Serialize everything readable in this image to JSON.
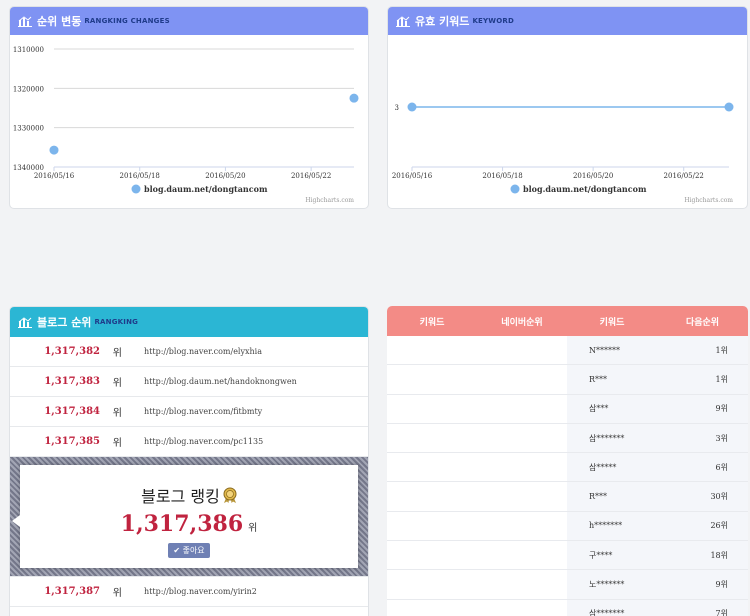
{
  "rank_chart": {
    "title": "순위 변동",
    "subtitle": "RANGKING CHANGES",
    "credit": "Highcharts.com",
    "chart_data": {
      "type": "scatter",
      "x": [
        "2016/05/16",
        "2016/05/23"
      ],
      "y": [
        1335700,
        1322500
      ],
      "xticks": [
        "2016/05/16",
        "2016/05/18",
        "2016/05/20",
        "2016/05/22"
      ],
      "yticks": [
        1310000,
        1320000,
        1330000,
        1340000
      ],
      "y_reversed": true,
      "ylim": [
        1310000,
        1340000
      ],
      "series": [
        {
          "name": "blog.daum.net/dongtancom"
        }
      ],
      "grid": true,
      "legend": "bottom-center"
    }
  },
  "keyword_chart": {
    "title": "유효 키워드",
    "subtitle": "KEYWORD",
    "credit": "Highcharts.com",
    "chart_data": {
      "type": "line",
      "x": [
        "2016/05/16",
        "2016/05/23"
      ],
      "y": [
        3,
        3
      ],
      "xticks": [
        "2016/05/16",
        "2016/05/18",
        "2016/05/20",
        "2016/05/22"
      ],
      "yticks": [
        3
      ],
      "series": [
        {
          "name": "blog.daum.net/dongtancom"
        }
      ],
      "legend": "bottom-center"
    }
  },
  "blog_rank": {
    "title": "블로그 순위",
    "subtitle": "RANGKING",
    "unit": "위",
    "rows_before": [
      {
        "rank": "1,317,382",
        "url": "http://blog.naver.com/elyxhia"
      },
      {
        "rank": "1,317,383",
        "url": "http://blog.daum.net/handoknongwen"
      },
      {
        "rank": "1,317,384",
        "url": "http://blog.naver.com/fitbmty"
      },
      {
        "rank": "1,317,385",
        "url": "http://blog.naver.com/pc1135"
      }
    ],
    "highlight": {
      "title": "블로그 랭킹",
      "rank": "1,317,386",
      "unit": "위",
      "like": "좋아요"
    },
    "rows_after": [
      {
        "rank": "1,317,387",
        "url": "http://blog.naver.com/yirin2"
      }
    ]
  },
  "keyword_table": {
    "headers": [
      "키워드",
      "네이버순위",
      "키워드",
      "다음순위"
    ],
    "rows": [
      {
        "keyword": "N******",
        "rank": "1위"
      },
      {
        "keyword": "R***",
        "rank": "1위"
      },
      {
        "keyword": "삼***",
        "rank": "9위"
      },
      {
        "keyword": "삼*******",
        "rank": "3위"
      },
      {
        "keyword": "삼*****",
        "rank": "6위"
      },
      {
        "keyword": "R***",
        "rank": "30위"
      },
      {
        "keyword": "h*******",
        "rank": "26위"
      },
      {
        "keyword": "구****",
        "rank": "18위"
      },
      {
        "keyword": "노*******",
        "rank": "9위"
      },
      {
        "keyword": "삼*******",
        "rank": "7위"
      }
    ]
  }
}
